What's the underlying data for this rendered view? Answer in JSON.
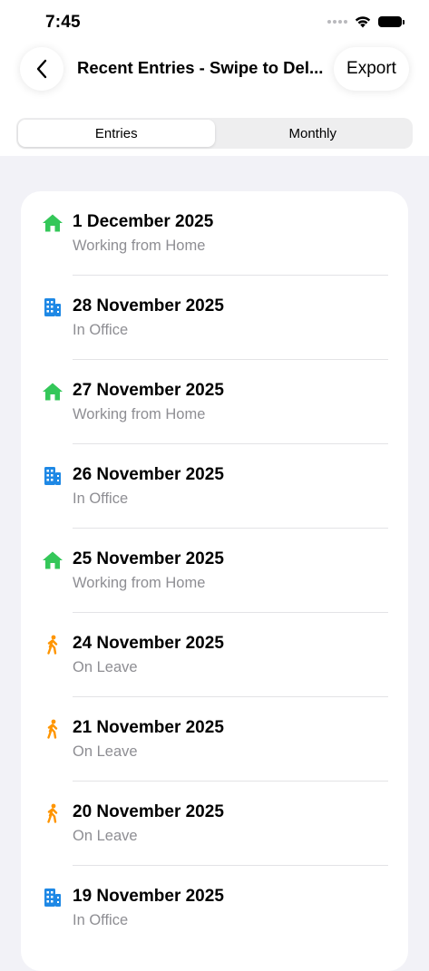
{
  "status": {
    "time": "7:45"
  },
  "nav": {
    "title": "Recent Entries - Swipe to Del...",
    "export_label": "Export"
  },
  "segments": [
    {
      "label": "Entries",
      "selected": true
    },
    {
      "label": "Monthly",
      "selected": false
    }
  ],
  "colors": {
    "home": "#34c759",
    "office": "#1e88e5",
    "leave": "#ff9500"
  },
  "entries": [
    {
      "date": "1 December 2025",
      "status": "Working from Home",
      "icon": "home-icon"
    },
    {
      "date": "28 November 2025",
      "status": "In Office",
      "icon": "office-building-icon"
    },
    {
      "date": "27 November 2025",
      "status": "Working from Home",
      "icon": "home-icon"
    },
    {
      "date": "26 November 2025",
      "status": "In Office",
      "icon": "office-building-icon"
    },
    {
      "date": "25 November 2025",
      "status": "Working from Home",
      "icon": "home-icon"
    },
    {
      "date": "24 November 2025",
      "status": "On Leave",
      "icon": "walking-person-icon"
    },
    {
      "date": "21 November 2025",
      "status": "On Leave",
      "icon": "walking-person-icon"
    },
    {
      "date": "20 November 2025",
      "status": "On Leave",
      "icon": "walking-person-icon"
    },
    {
      "date": "19 November 2025",
      "status": "In Office",
      "icon": "office-building-icon"
    }
  ]
}
